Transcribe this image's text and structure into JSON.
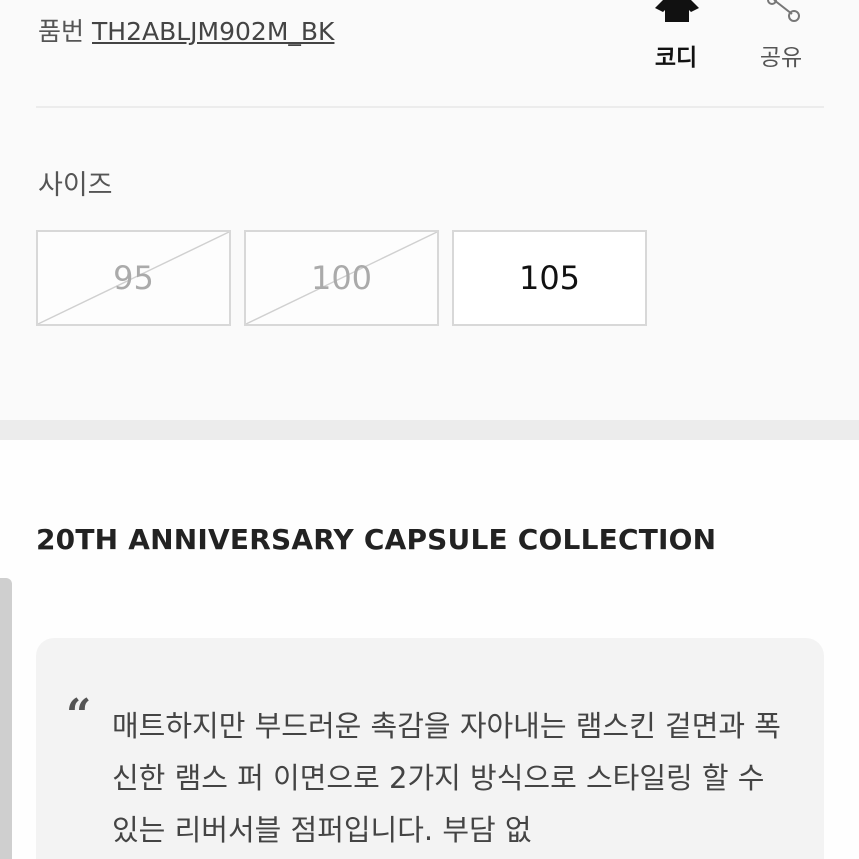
{
  "product": {
    "code_label": "품번",
    "code_value": "TH2ABLJM902M_BK"
  },
  "actions": {
    "coordi_label": "코디",
    "share_label": "공유"
  },
  "sizes": {
    "label": "사이즈",
    "options": [
      {
        "value": "95",
        "available": false
      },
      {
        "value": "100",
        "available": false
      },
      {
        "value": "105",
        "available": true
      }
    ]
  },
  "collection": {
    "title": "20TH ANNIVERSARY CAPSULE COLLECTION",
    "quote_mark": "“",
    "description": "매트하지만 부드러운 촉감을 자아내는 램스킨 겉면과 폭신한 램스 퍼 이면으로 2가지 방식으로 스타일링 할 수 있는 리버서블 점퍼입니다. 부담 없"
  }
}
